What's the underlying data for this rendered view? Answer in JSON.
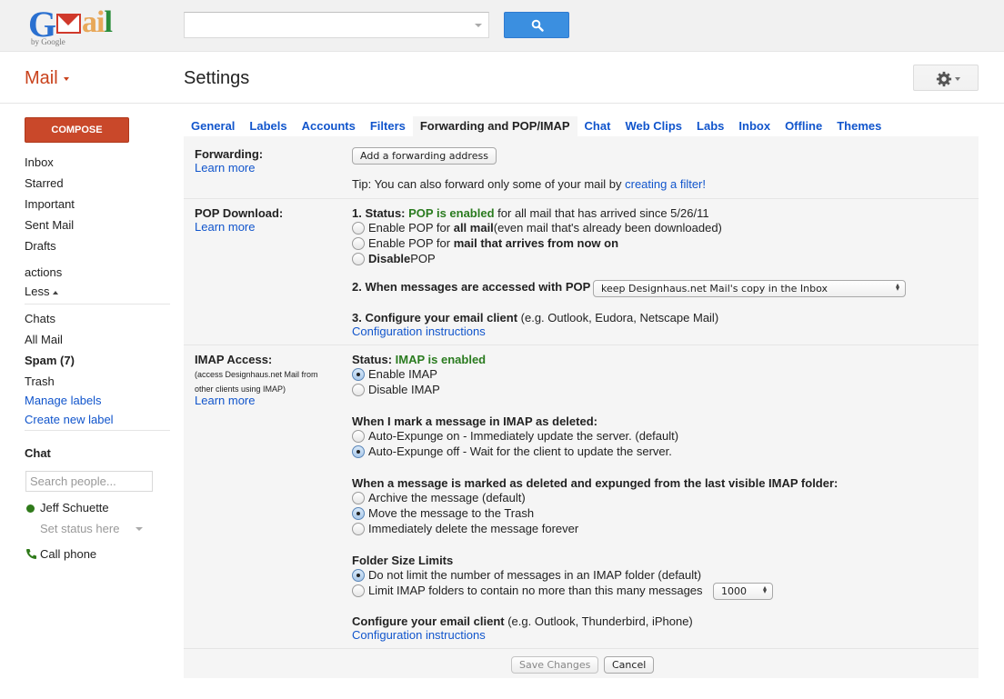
{
  "topbar": {
    "logo_text": "Gmail",
    "logo_sub": "by Google",
    "search_value": "",
    "search_placeholder": ""
  },
  "header": {
    "mail_menu": "Mail",
    "page_title": "Settings"
  },
  "sidebar": {
    "compose_label": "COMPOSE",
    "items": [
      {
        "label": "Inbox"
      },
      {
        "label": "Starred"
      },
      {
        "label": "Important"
      },
      {
        "label": "Sent Mail"
      },
      {
        "label": "Drafts"
      },
      {
        "label": "actions"
      },
      {
        "label": "Less"
      },
      {
        "label": "Chats"
      },
      {
        "label": "All Mail"
      },
      {
        "label": "Spam (7)"
      },
      {
        "label": "Trash"
      },
      {
        "label": "Manage labels"
      },
      {
        "label": "Create new label"
      }
    ],
    "chat": {
      "title": "Chat",
      "search_placeholder": "Search people...",
      "user_name": "Jeff Schuette",
      "status_placeholder": "Set status here",
      "call_phone": "Call phone"
    }
  },
  "tabs": [
    {
      "label": "General",
      "active": false
    },
    {
      "label": "Labels",
      "active": false
    },
    {
      "label": "Accounts",
      "active": false
    },
    {
      "label": "Filters",
      "active": false
    },
    {
      "label": "Forwarding and POP/IMAP",
      "active": true
    },
    {
      "label": "Chat",
      "active": false
    },
    {
      "label": "Web Clips",
      "active": false
    },
    {
      "label": "Labs",
      "active": false
    },
    {
      "label": "Inbox",
      "active": false
    },
    {
      "label": "Offline",
      "active": false
    },
    {
      "label": "Themes",
      "active": false
    }
  ],
  "forwarding": {
    "label": "Forwarding:",
    "learn_more": "Learn more",
    "add_button": "Add a forwarding address",
    "tip_prefix": "Tip: You can also forward only some of your mail by ",
    "tip_link": "creating a filter!"
  },
  "pop": {
    "label": "POP Download:",
    "learn_more": "Learn more",
    "status_prefix": "1. Status: ",
    "status_value": "POP is enabled",
    "status_suffix": " for all mail that has arrived since 5/26/11",
    "options": [
      {
        "pre": "Enable POP for ",
        "bold": "all mail",
        "post": " (even mail that's already been downloaded)",
        "checked": false
      },
      {
        "pre": "Enable POP for ",
        "bold": "mail that arrives from now on",
        "post": "",
        "checked": false
      },
      {
        "pre": "",
        "bold": "Disable",
        "post": " POP",
        "checked": false
      }
    ],
    "access_label": "2. When messages are accessed with POP",
    "access_select": "keep Designhaus.net Mail's copy in the Inbox",
    "configure_bold": "3. Configure your email client",
    "configure_rest": " (e.g. Outlook, Eudora, Netscape Mail)",
    "config_link": "Configuration instructions"
  },
  "imap": {
    "label": "IMAP Access:",
    "sub1": "(access Designhaus.net Mail from",
    "sub2": "other clients using IMAP)",
    "learn_more": "Learn more",
    "status_prefix": "Status: ",
    "status_value": "IMAP is enabled",
    "enable_options": [
      {
        "label": "Enable IMAP",
        "checked": true
      },
      {
        "label": "Disable IMAP",
        "checked": false
      }
    ],
    "deleted_heading": "When I mark a message in IMAP as deleted:",
    "deleted_options": [
      {
        "label": "Auto-Expunge on - Immediately update the server. (default)",
        "checked": false
      },
      {
        "label": "Auto-Expunge off - Wait for the client to update the server.",
        "checked": true
      }
    ],
    "expunged_heading": "When a message is marked as deleted and expunged from the last visible IMAP folder:",
    "expunged_options": [
      {
        "label": "Archive the message (default)",
        "checked": false
      },
      {
        "label": "Move the message to the Trash",
        "checked": true
      },
      {
        "label": "Immediately delete the message forever",
        "checked": false
      }
    ],
    "folder_heading": "Folder Size Limits",
    "folder_options": [
      {
        "label": "Do not limit the number of messages in an IMAP folder (default)",
        "checked": true
      },
      {
        "label": "Limit IMAP folders to contain no more than this many messages",
        "checked": false
      }
    ],
    "folder_limit_select": "1000",
    "configure_bold": "Configure your email client",
    "configure_rest": " (e.g. Outlook, Thunderbird, iPhone)",
    "config_link": "Configuration instructions"
  },
  "footer": {
    "save_label": "Save Changes",
    "cancel_label": "Cancel"
  }
}
